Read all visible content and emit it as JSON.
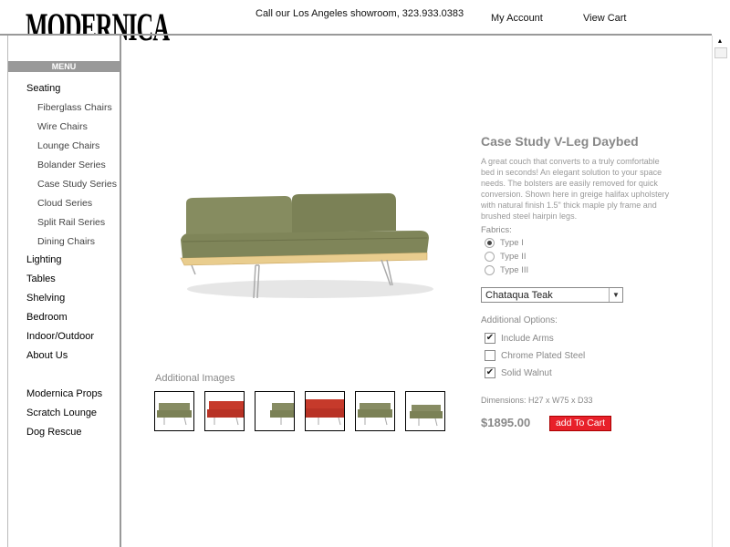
{
  "header": {
    "logo_text": "MODERNICA",
    "phone_text": "Call our Los Angeles showroom, 323.933.0383",
    "account_label": "My Account",
    "cart_label": "View Cart"
  },
  "sidebar": {
    "menu_label": "MENU",
    "items": [
      {
        "label": "Seating",
        "sub": false
      },
      {
        "label": "Fiberglass Chairs",
        "sub": true
      },
      {
        "label": "Wire Chairs",
        "sub": true
      },
      {
        "label": "Lounge Chairs",
        "sub": true
      },
      {
        "label": "Bolander Series",
        "sub": true
      },
      {
        "label": "Case Study Series",
        "sub": true
      },
      {
        "label": "Cloud Series",
        "sub": true
      },
      {
        "label": "Split Rail Series",
        "sub": true
      },
      {
        "label": "Dining Chairs",
        "sub": true
      },
      {
        "label": "Lighting",
        "sub": false
      },
      {
        "label": "Tables",
        "sub": false
      },
      {
        "label": "Shelving",
        "sub": false
      },
      {
        "label": "Bedroom",
        "sub": false
      },
      {
        "label": "Indoor/Outdoor",
        "sub": false
      },
      {
        "label": "About Us",
        "sub": false
      },
      {
        "label": "Modernica Props",
        "sub": false
      },
      {
        "label": "Scratch Lounge",
        "sub": false
      },
      {
        "label": "Dog Rescue",
        "sub": false
      }
    ]
  },
  "product": {
    "title": "Case Study V-Leg Daybed",
    "description": "A great couch that converts to a truly comfortable bed in seconds! An elegant solution to your space needs. The bolsters are easily removed for quick conversion. Shown here in greige halifax upholstery with natural finish 1.5\" thick maple ply frame and brushed steel hairpin legs.",
    "fabrics_label": "Fabrics:",
    "fabrics": [
      {
        "label": "Type I",
        "selected": true
      },
      {
        "label": "Type II",
        "selected": false
      },
      {
        "label": "Type III",
        "selected": false
      }
    ],
    "finish_select": "Chataqua Teak",
    "additional_options_label": "Additional Options:",
    "options": [
      {
        "label": "Include Arms",
        "checked": true
      },
      {
        "label": "Chrome Plated Steel",
        "checked": false
      },
      {
        "label": "Solid Walnut",
        "checked": true
      }
    ],
    "dimensions": "Dimensions: H27 x W75 x D33",
    "price": "$1895.00",
    "add_to_cart_label": "add To Cart"
  },
  "additional_images": {
    "label": "Additional Images",
    "thumbs": [
      {
        "color": "#8a8f6a",
        "icon": "sofa-olive-thumb"
      },
      {
        "color": "#c0392b",
        "icon": "sofa-red-thumb"
      },
      {
        "color": "#8a8f6a",
        "icon": "sofa-olive-thumb"
      },
      {
        "color": "#c0392b",
        "icon": "sofa-red-thumb"
      },
      {
        "color": "#8a8f6a",
        "icon": "sofa-olive-thumb"
      },
      {
        "color": "#8a8f6a",
        "icon": "sofa-olive-thumb"
      }
    ]
  },
  "colors": {
    "accent_red": "#e8202a",
    "upholstery_olive": "#7d8359",
    "frame_maple": "#e6c98a"
  }
}
